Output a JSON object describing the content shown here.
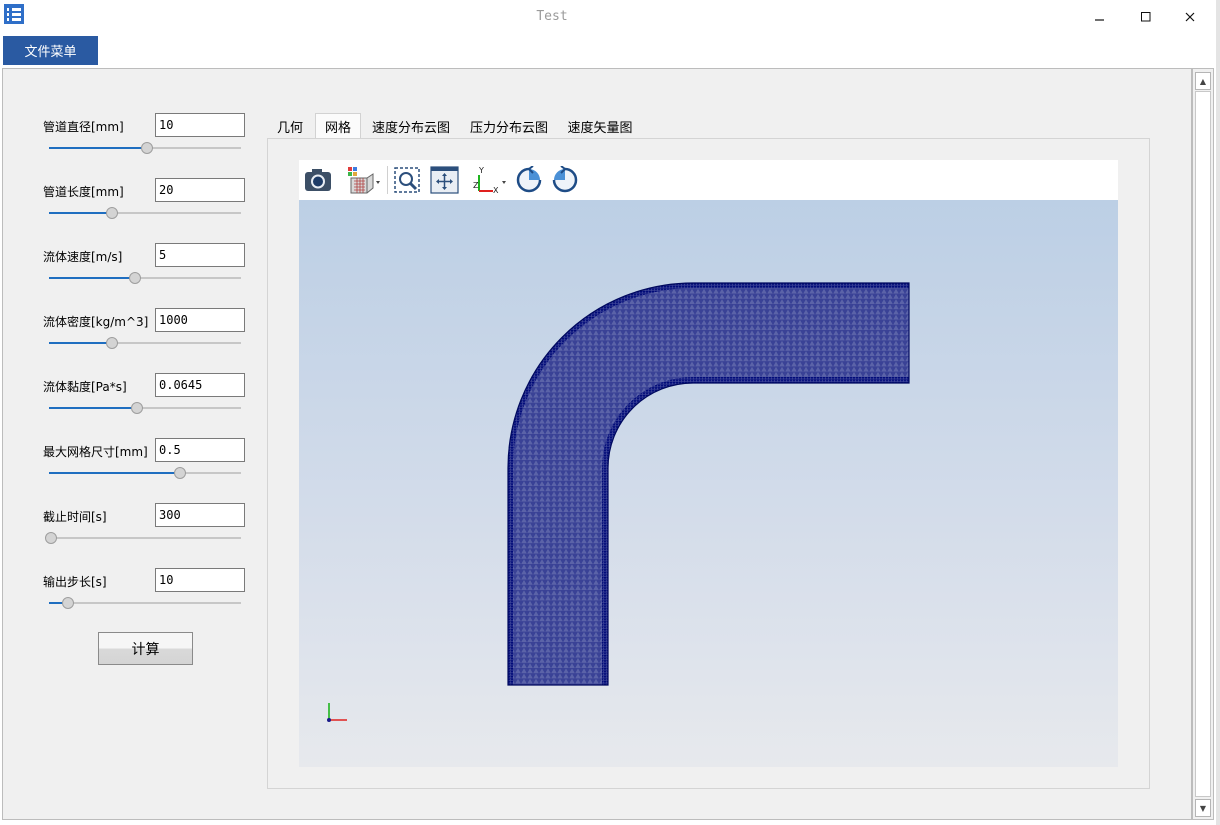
{
  "window": {
    "title": "Test"
  },
  "menu": {
    "file_menu": "文件菜单"
  },
  "params": [
    {
      "label": "管道直径[mm]",
      "value": "10",
      "slider_fraction": 0.51
    },
    {
      "label": "管道长度[mm]",
      "value": "20",
      "slider_fraction": 0.33
    },
    {
      "label": "流体速度[m/s]",
      "value": "5",
      "slider_fraction": 0.45
    },
    {
      "label": "流体密度[kg/m^3]",
      "value": "1000",
      "slider_fraction": 0.33
    },
    {
      "label": "流体黏度[Pa*s]",
      "value": "0.0645",
      "slider_fraction": 0.46
    },
    {
      "label": "最大网格尺寸[mm]",
      "value": "0.5",
      "slider_fraction": 0.68
    },
    {
      "label": "截止时间[s]",
      "value": "300",
      "slider_fraction": 0.01
    },
    {
      "label": "输出步长[s]",
      "value": "10",
      "slider_fraction": 0.1
    }
  ],
  "buttons": {
    "calculate": "计算"
  },
  "tabs": [
    {
      "label": "几何",
      "active": false
    },
    {
      "label": "网格",
      "active": true
    },
    {
      "label": "速度分布云图",
      "active": false
    },
    {
      "label": "压力分布云图",
      "active": false
    },
    {
      "label": "速度矢量图",
      "active": false
    }
  ],
  "toolbar_icons": [
    "camera-icon",
    "display-mode-icon",
    "zoom-box-icon",
    "fit-view-icon",
    "axis-orientation-icon",
    "rotate-cw-icon",
    "rotate-ccw-icon"
  ],
  "colors": {
    "menu_accent": "#2a5aa2",
    "slider_fill": "#1f6ec0",
    "mesh": "#000c80",
    "axis_x": "#e0201e",
    "axis_y": "#1eb41e"
  }
}
